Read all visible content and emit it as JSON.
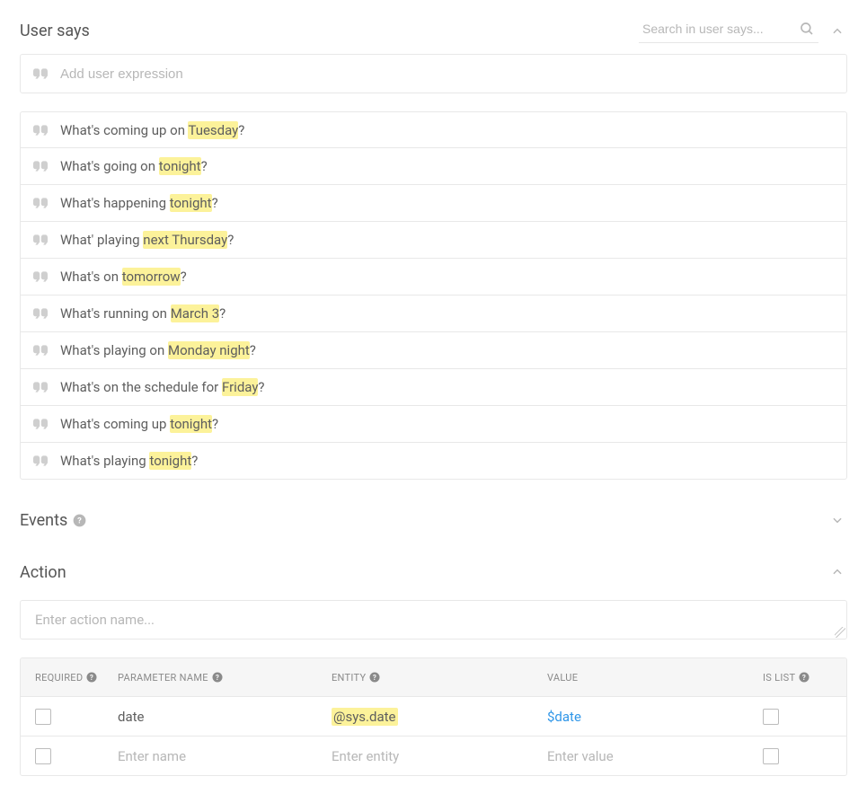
{
  "userSays": {
    "title": "User says",
    "searchPlaceholder": "Search in user says...",
    "addPlaceholder": "Add user expression",
    "expressions": [
      {
        "pre": "What's coming up on ",
        "hl": "Tuesday",
        "post": "?"
      },
      {
        "pre": "What's going on ",
        "hl": "tonight",
        "post": "?"
      },
      {
        "pre": "What's happening ",
        "hl": "tonight",
        "post": "?"
      },
      {
        "pre": "What' playing ",
        "hl": "next Thursday",
        "post": "?"
      },
      {
        "pre": "What's on ",
        "hl": "tomorrow",
        "post": "?"
      },
      {
        "pre": "What's running on ",
        "hl": "March 3",
        "post": "?"
      },
      {
        "pre": "What's playing on ",
        "hl": "Monday night",
        "post": "?"
      },
      {
        "pre": "What's on the schedule for ",
        "hl": "Friday",
        "post": "?"
      },
      {
        "pre": "What's coming up ",
        "hl": "tonight",
        "post": "?"
      },
      {
        "pre": "What's playing ",
        "hl": "tonight",
        "post": "?"
      }
    ]
  },
  "events": {
    "title": "Events"
  },
  "action": {
    "title": "Action",
    "inputPlaceholder": "Enter action name...",
    "columns": {
      "required": "REQUIRED",
      "paramName": "PARAMETER NAME",
      "entity": "ENTITY",
      "value": "VALUE",
      "isList": "IS LIST"
    },
    "rows": [
      {
        "requiredChecked": false,
        "name": "date",
        "namePlaceholder": "Enter name",
        "entity": "@sys.date",
        "entityPlaceholder": "Enter entity",
        "value": "$date",
        "valuePlaceholder": "Enter value",
        "isListChecked": false
      },
      {
        "requiredChecked": false,
        "name": "",
        "namePlaceholder": "Enter name",
        "entity": "",
        "entityPlaceholder": "Enter entity",
        "value": "",
        "valuePlaceholder": "Enter value",
        "isListChecked": false
      }
    ]
  }
}
